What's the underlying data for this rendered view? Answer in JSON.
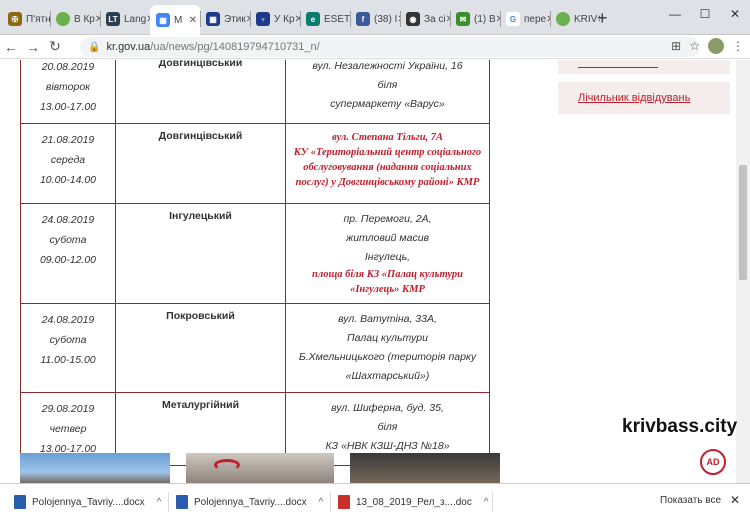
{
  "browser": {
    "tabs": [
      {
        "label": "П'ятн",
        "fav_color": "#8b6914",
        "fav_glyph": "✠"
      },
      {
        "label": "В Кр",
        "fav_color": "#6ab04c",
        "fav_glyph": ""
      },
      {
        "label": "Lang",
        "fav_color": "#2c3e50",
        "fav_glyph": "LT"
      },
      {
        "label": "М",
        "fav_color": "#4285f4",
        "fav_glyph": "▦",
        "active": true
      },
      {
        "label": "Этик",
        "fav_color": "#1e3a8a",
        "fav_glyph": "▦"
      },
      {
        "label": "У Кр",
        "fav_color": "#1e3a8a",
        "fav_glyph": "♆"
      },
      {
        "label": "ESET",
        "fav_color": "#0a7c70",
        "fav_glyph": "e"
      },
      {
        "label": "(38) I",
        "fav_color": "#3b5998",
        "fav_glyph": "f"
      },
      {
        "label": "За сі",
        "fav_color": "#333333",
        "fav_glyph": "◉"
      },
      {
        "label": "(1) В",
        "fav_color": "#3c8d2f",
        "fav_glyph": "✉"
      },
      {
        "label": "пере",
        "fav_color": "#ffffff",
        "fav_glyph": "G"
      },
      {
        "label": "KRIV",
        "fav_color": "#6ab04c",
        "fav_glyph": ""
      }
    ],
    "new_tab": "+",
    "url_domain": "kr.gov.ua",
    "url_path": "/ua/news/pg/140819794710731_n/"
  },
  "schedule": {
    "rows": [
      {
        "date": "20.08.2019",
        "day": "вівторок",
        "time": "13.00-17.00",
        "district": "Довгинцівський",
        "addr": [
          "вул. Незалежності України, 16",
          "біля",
          "супермаркету «Варус»"
        ],
        "addr_red": ""
      },
      {
        "date": "21.08.2019",
        "day": "середа",
        "time": "10.00-14.00",
        "district": "Довгинцівський",
        "addr": [],
        "addr_red": "вул. Степана Тільги, 7А\nКУ «Територіальний центр соціального обслуговування (надання соціальних послуг) у Довгинцівському районі» КМР"
      },
      {
        "date": "24.08.2019",
        "day": "субота",
        "time": "09.00-12.00",
        "district": "Інгулецький",
        "addr": [
          "пр. Перемоги, 2А,",
          "житловий масив",
          "Інгулець,"
        ],
        "addr_red": "площа біля КЗ «Палац культури «Інгулець» КМР"
      },
      {
        "date": "24.08.2019",
        "day": "субота",
        "time": "11.00-15.00",
        "district": "Покровський",
        "addr": [
          "вул. Ватутіна, 33А,",
          "Палац культури",
          "Б.Хмельницького (територія парку «Шахтарський»)"
        ],
        "addr_red": ""
      },
      {
        "date": "29.08.2019",
        "day": "четвер",
        "time": "13.00-17.00",
        "district": "Металургійний",
        "addr": [
          "вул. Шиферна, буд. 35,",
          "біля",
          "КЗ «НВК КЗШ-ДНЗ №18»"
        ],
        "addr_red": ""
      }
    ]
  },
  "sidebar": {
    "visitors_link": "Лічильник відвідувань"
  },
  "watermark": {
    "brand": "krivbass.city",
    "logo": "AD"
  },
  "downloads": {
    "items": [
      {
        "name": "Polojennya_Tavriy....docx",
        "type": "doc"
      },
      {
        "name": "Polojennya_Tavriy....docx",
        "type": "doc"
      },
      {
        "name": "13_08_2019_Рел_з....doc",
        "type": "pdf"
      }
    ],
    "show_all": "Показать все",
    "close": "✕"
  }
}
